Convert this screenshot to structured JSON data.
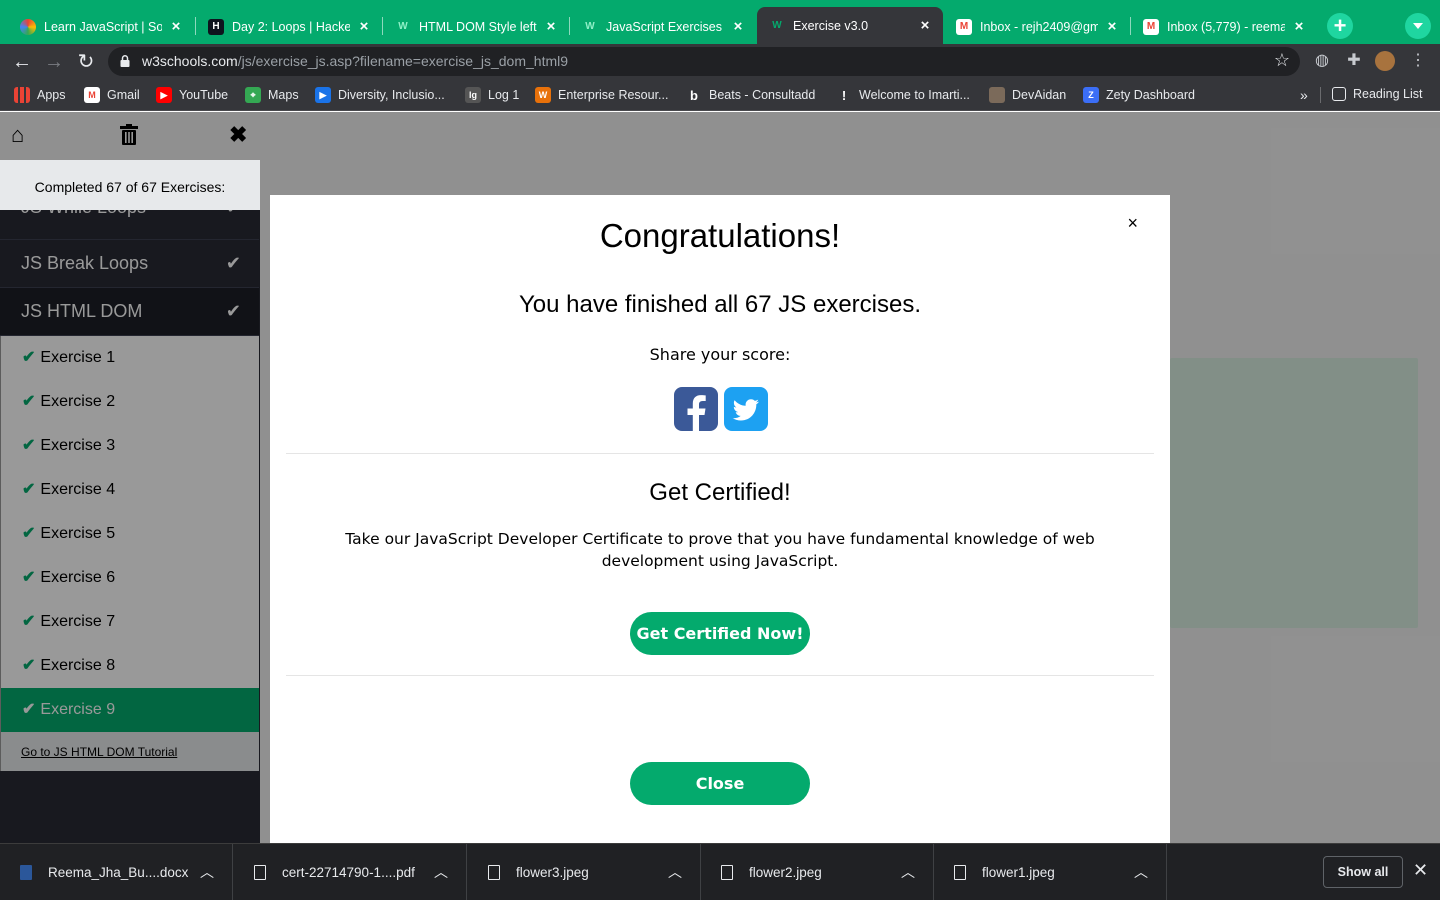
{
  "browser": {
    "tabs": [
      {
        "title": "Learn JavaScript | Sol",
        "favicon": "colorful-circle-icon"
      },
      {
        "title": "Day 2: Loops | Hacke",
        "favicon": "hackerrank-icon"
      },
      {
        "title": "HTML DOM Style left",
        "favicon": "w3schools-icon"
      },
      {
        "title": "JavaScript Exercises",
        "favicon": "w3schools-icon"
      },
      {
        "title": "Exercise v3.0",
        "favicon": "w3schools-icon",
        "active": true
      },
      {
        "title": "Inbox - rejh2409@gm",
        "favicon": "gmail-icon"
      },
      {
        "title": "Inbox (5,779) - reema",
        "favicon": "gmail-icon"
      }
    ],
    "url_host": "w3schools.com",
    "url_path": "/js/exercise_js.asp?filename=exercise_js_dom_html9",
    "bookmarks": [
      "Apps",
      "Gmail",
      "YouTube",
      "Maps",
      "Diversity, Inclusio...",
      "Log 1",
      "Enterprise Resour...",
      "Beats - Consultadd",
      "Welcome to Imarti...",
      "DevAidan",
      "Zety Dashboard"
    ],
    "bookmarks_overflow": "»",
    "reading_list": "Reading List",
    "accent_color": "#04aa6d"
  },
  "sidebar": {
    "completed_text": "Completed 67 of 67 Exercises:",
    "sections": [
      "JS While Loops",
      "JS Break Loops",
      "JS HTML DOM"
    ],
    "exercises": [
      "Exercise 1",
      "Exercise 2",
      "Exercise 3",
      "Exercise 4",
      "Exercise 5",
      "Exercise 6",
      "Exercise 7",
      "Exercise 8",
      "Exercise 9"
    ],
    "active_exercise": "Exercise 9",
    "tutorial_link": "Go to JS HTML DOM Tutorial"
  },
  "modal": {
    "close_symbol": "×",
    "title": "Congratulations!",
    "subtitle": "You have finished all 67 JS exercises.",
    "share_label": "Share your score:",
    "cert_heading": "Get Certified!",
    "cert_text": "Take our JavaScript Developer Certificate to prove that you have fundamental knowledge of web development using JavaScript.",
    "cert_button": "Get Certified Now!",
    "close_button": "Close"
  },
  "downloads": {
    "items": [
      "Reema_Jha_Bu....docx",
      "cert-22714790-1....pdf",
      "flower3.jpeg",
      "flower2.jpeg",
      "flower1.jpeg"
    ],
    "show_all": "Show all"
  }
}
